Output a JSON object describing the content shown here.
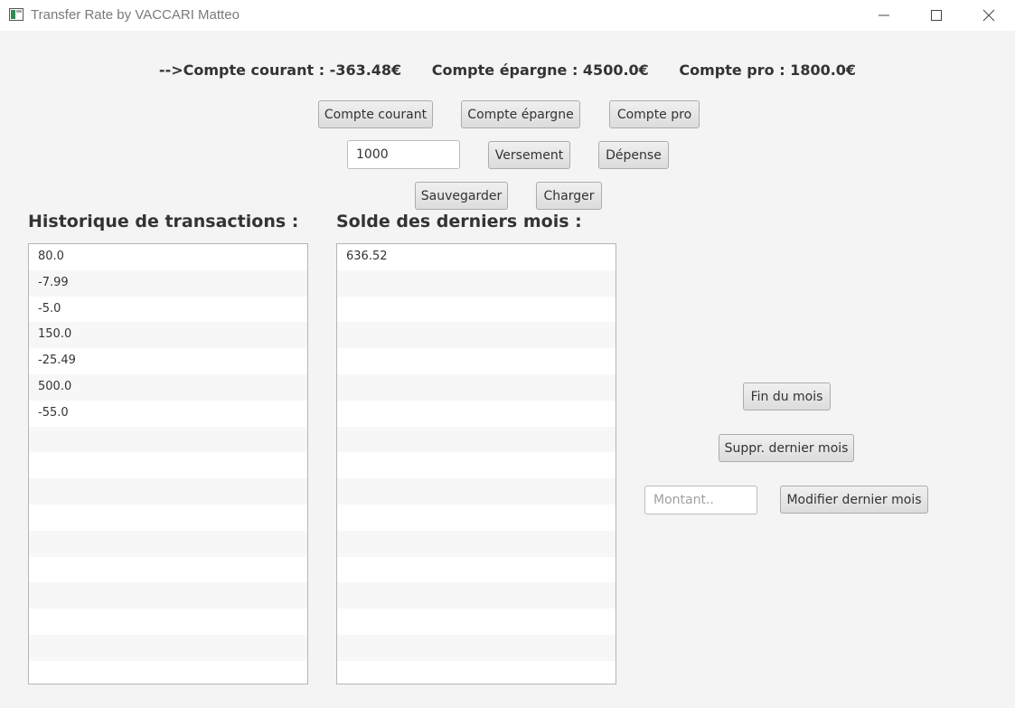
{
  "window": {
    "title": "Transfer Rate by VACCARI Matteo",
    "controls": [
      "minimize-icon",
      "maximize-icon",
      "close-icon"
    ]
  },
  "balances": {
    "courant": "-->Compte courant : -363.48€",
    "epargne": "Compte épargne : 4500.0€",
    "pro": "Compte pro : 1800.0€"
  },
  "account_buttons": {
    "courant": "Compte courant",
    "epargne": "Compte épargne",
    "pro": "Compte pro"
  },
  "amount_input": {
    "value": "1000"
  },
  "operation_buttons": {
    "versement": "Versement",
    "depense": "Dépense"
  },
  "file_buttons": {
    "save": "Sauvegarder",
    "load": "Charger"
  },
  "transactions": {
    "heading": "Historique de transactions :",
    "items": [
      "80.0",
      "-7.99",
      "-5.0",
      "150.0",
      "-25.49",
      "500.0",
      "-55.0",
      "",
      "",
      "",
      "",
      "",
      "",
      "",
      "",
      "",
      ""
    ]
  },
  "monthly": {
    "heading": "Solde des derniers mois :",
    "items": [
      "636.52",
      "",
      "",
      "",
      "",
      "",
      "",
      "",
      "",
      "",
      "",
      "",
      "",
      "",
      "",
      "",
      ""
    ]
  },
  "month_controls": {
    "end_month": "Fin du mois",
    "delete_last": "Suppr. dernier mois",
    "amount_placeholder": "Montant..",
    "modify_last": "Modifier dernier mois"
  }
}
